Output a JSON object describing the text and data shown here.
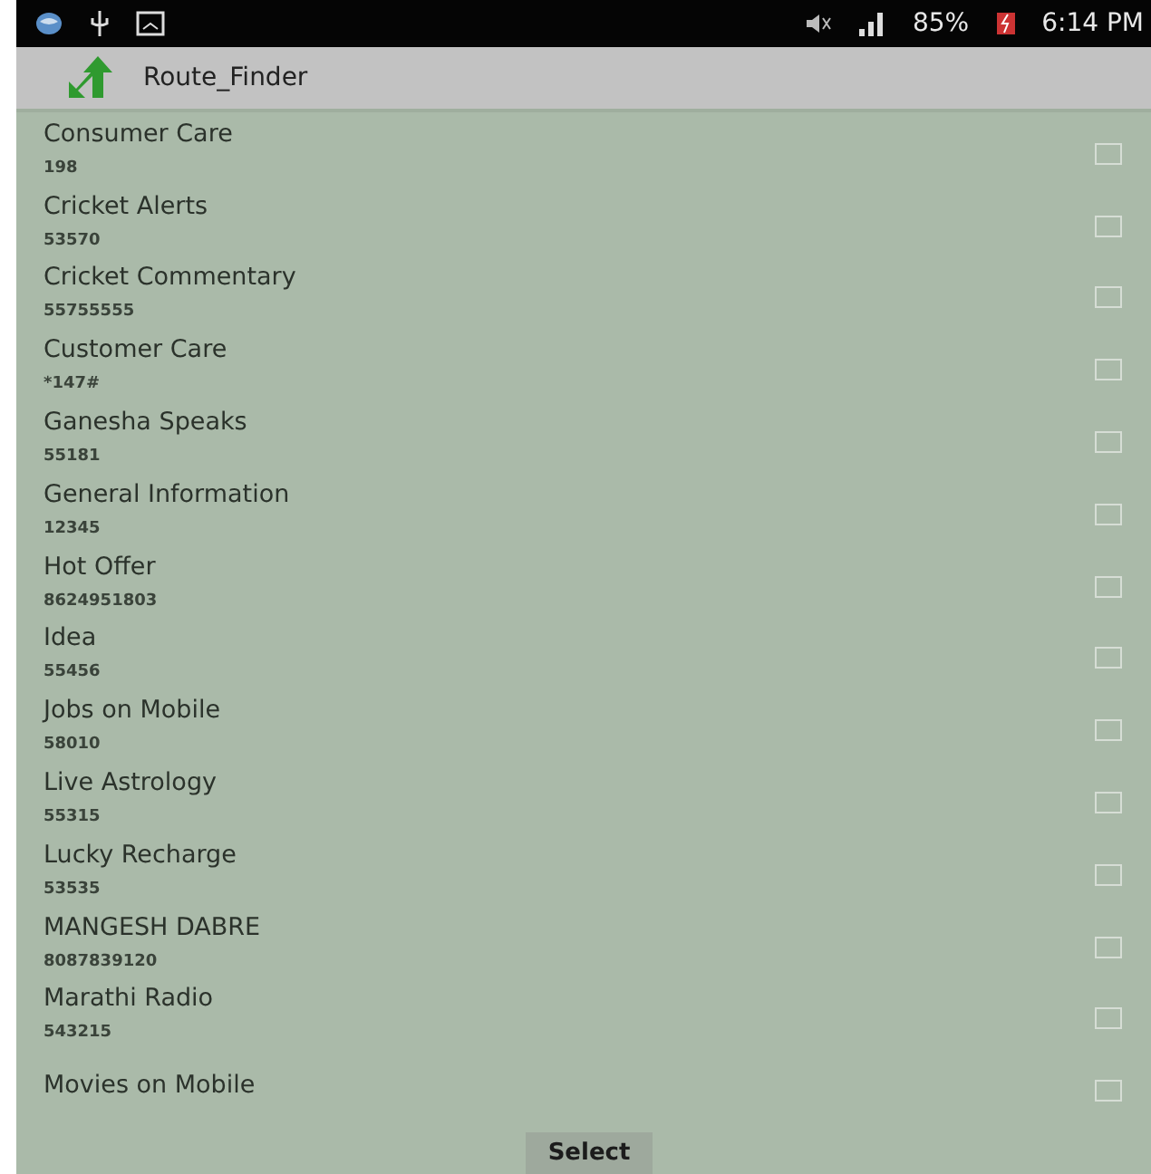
{
  "status_bar": {
    "battery": "85%",
    "time": "6:14 PM"
  },
  "app_bar": {
    "title": "Route_Finder"
  },
  "contacts": [
    {
      "name": "Consumer Care",
      "number": "198",
      "checked": false
    },
    {
      "name": "Cricket Alerts",
      "number": "53570",
      "checked": false
    },
    {
      "name": "Cricket Commentary",
      "number": "55755555",
      "checked": false
    },
    {
      "name": "Customer Care",
      "number": "*147#",
      "checked": false
    },
    {
      "name": "Ganesha Speaks",
      "number": "55181",
      "checked": false
    },
    {
      "name": "General Information",
      "number": "12345",
      "checked": false
    },
    {
      "name": "Hot Offer",
      "number": "8624951803",
      "checked": false
    },
    {
      "name": "Idea",
      "number": "55456",
      "checked": false
    },
    {
      "name": "Jobs on Mobile",
      "number": "58010",
      "checked": false
    },
    {
      "name": "Live Astrology",
      "number": "55315",
      "checked": false
    },
    {
      "name": "Lucky Recharge",
      "number": "53535",
      "checked": false
    },
    {
      "name": "MANGESH DABRE",
      "number": "8087839120",
      "checked": false
    },
    {
      "name": "Marathi Radio",
      "number": "543215",
      "checked": false
    },
    {
      "name": "Movies on Mobile",
      "checked": false
    }
  ],
  "select_button": "Select"
}
